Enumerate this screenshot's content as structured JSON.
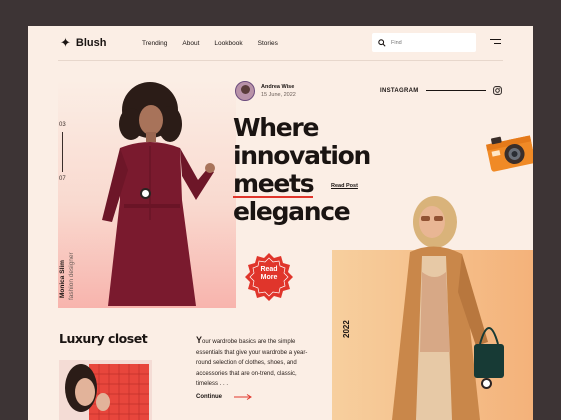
{
  "brand": {
    "name": "Blush",
    "logo_icon": "four-point-star-icon"
  },
  "nav": [
    {
      "label": "Trending"
    },
    {
      "label": "About"
    },
    {
      "label": "Lookbook"
    },
    {
      "label": "Stories"
    }
  ],
  "search": {
    "placeholder": "Find"
  },
  "slider": {
    "current": "03",
    "total": "07"
  },
  "model": {
    "name": "Monica Slim",
    "role": "fashion designer"
  },
  "author": {
    "name": "Andrea Wise",
    "date": "15 June, 2022"
  },
  "instagram": {
    "label": "INSTAGRAM"
  },
  "headline": {
    "line1": "Where",
    "line2": "innovation",
    "line3": "meets",
    "line4": "elegance"
  },
  "read_post": "Read Post",
  "badge": {
    "line1": "Read",
    "line2": "More"
  },
  "year": "2022",
  "luxury": {
    "title": "Luxury closet",
    "first_letter": "Y",
    "text": "our wardrobe basics are the simple essentials that give your wardrobe a year-round selection of clothes, shoes, and accessories that are on-trend, classic, timeless . . .",
    "continue": "Continue"
  },
  "colors": {
    "accent": "#e0352b",
    "background": "#fbeee5",
    "frame": "#3d3435",
    "orange": "#f4b27a"
  }
}
